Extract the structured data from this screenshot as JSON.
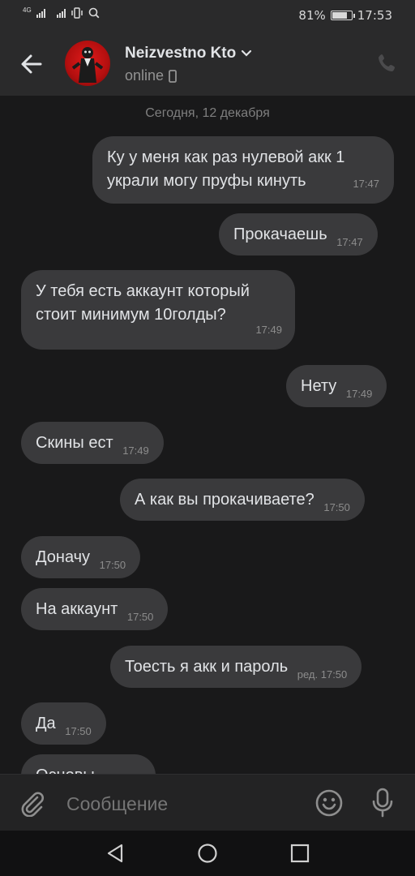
{
  "status_bar": {
    "network_label": "4G",
    "battery_text": "81%",
    "battery_level": 0.81,
    "time": "17:53"
  },
  "header": {
    "title": "Neizvestno Kto",
    "subtitle": "online"
  },
  "chat": {
    "date_divider": "Сегодня, 12 декабря",
    "messages": [
      {
        "side": "out",
        "text": "Ку у меня как раз нулевой акк 1 украли могу пруфы кинуть",
        "time": "17:47"
      },
      {
        "side": "out",
        "text": "Прокачаешь",
        "time": "17:47"
      },
      {
        "side": "in",
        "text": "У тебя есть аккаунт который стоит минимум 10голды?",
        "time": "17:49"
      },
      {
        "side": "out",
        "text": "Нету",
        "time": "17:49"
      },
      {
        "side": "in",
        "text": "Скины ест",
        "time": "17:49"
      },
      {
        "side": "out",
        "text": "А как вы прокачиваете?",
        "time": "17:50"
      },
      {
        "side": "in",
        "text": "Доначу",
        "time": "17:50"
      },
      {
        "side": "in",
        "text": "На аккаунт",
        "time": "17:50"
      },
      {
        "side": "out",
        "text": "Тоесть я акк и пароль",
        "time": "ред. 17:50"
      },
      {
        "side": "in",
        "text": "Да",
        "time": "17:50"
      },
      {
        "side": "in",
        "text": "Основы",
        "time": ""
      }
    ]
  },
  "composer": {
    "placeholder": "Сообщение"
  },
  "icons": {
    "back": "arrow-left-icon",
    "phone": "phone-icon",
    "attach": "paperclip-icon",
    "emoji": "smile-icon",
    "voice": "microphone-icon",
    "nav_back": "triangle-back-icon",
    "nav_home": "circle-home-icon",
    "nav_recent": "square-recent-icon"
  },
  "colors": {
    "background": "#19191a",
    "bubble": "#3a3a3c",
    "header": "#2a2a2b",
    "text": "#e1e3e6",
    "muted": "#8c8c8c"
  }
}
